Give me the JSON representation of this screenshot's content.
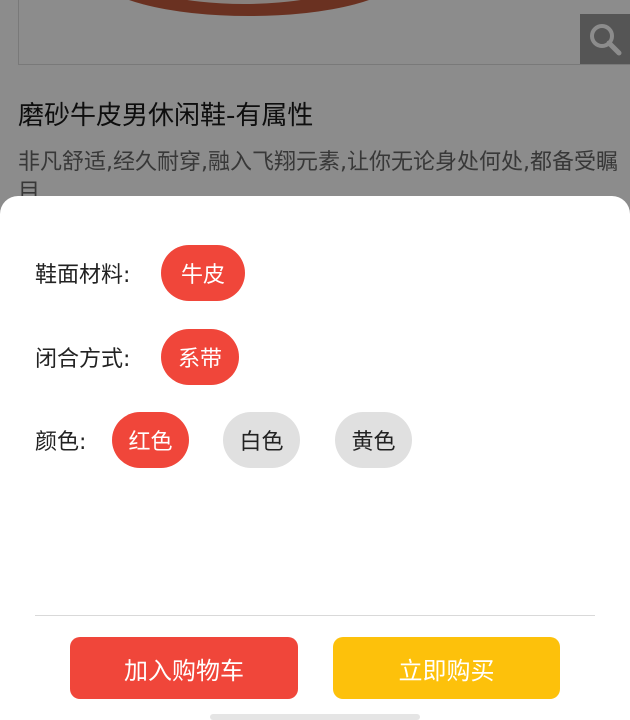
{
  "product": {
    "title": "磨砂牛皮男休闲鞋-有属性",
    "description": "非凡舒适,经久耐穿,融入飞翔元素,让你无论身处何处,都备受瞩目"
  },
  "icons": {
    "zoom": "search-icon"
  },
  "attributes": [
    {
      "label": "鞋面材料:",
      "options": [
        {
          "label": "牛皮",
          "selected": true
        }
      ]
    },
    {
      "label": "闭合方式:",
      "options": [
        {
          "label": "系带",
          "selected": true
        }
      ]
    },
    {
      "label": "颜色:",
      "options": [
        {
          "label": "红色",
          "selected": true
        },
        {
          "label": "白色",
          "selected": false
        },
        {
          "label": "黄色",
          "selected": false
        }
      ]
    }
  ],
  "actions": {
    "add_to_cart": "加入购物车",
    "buy_now": "立即购买"
  },
  "colors": {
    "accent_red": "#f0463a",
    "accent_yellow": "#fdc10b",
    "chip_unselected": "#e0e0e0"
  }
}
